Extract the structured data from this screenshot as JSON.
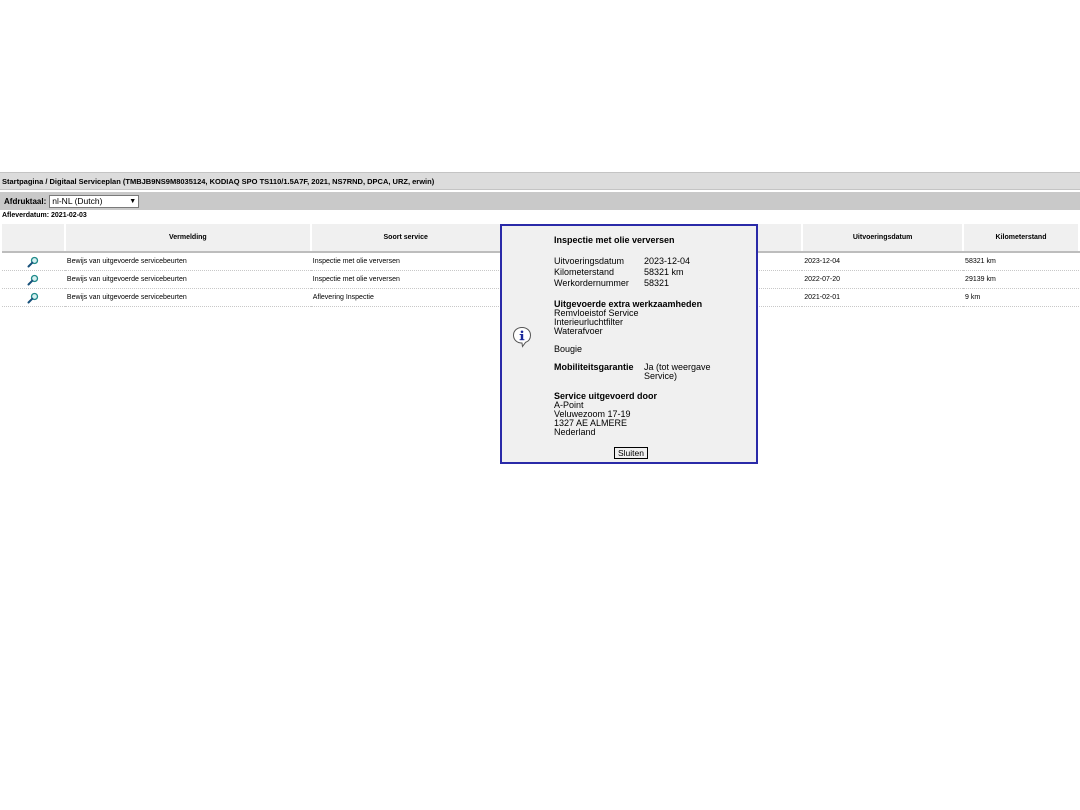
{
  "breadcrumb": "Startpagina / Digitaal Serviceplan (TMBJB9NS9M8035124, KODIAQ SPO TS110/1.5A7F, 2021, NS7RND, DPCA, URZ, erwin)",
  "language": {
    "label": "Afdruktaal:",
    "selected": "nl-NL (Dutch)"
  },
  "delivery_date": "Afleverdatum: 2021-02-03",
  "table": {
    "headers": [
      "",
      "Vermelding",
      "Soort service",
      "",
      "Uitvoeringsdatum",
      "Kilometerstand"
    ],
    "rows": [
      {
        "icon": "magnifier-icon",
        "vermelding": "Bewijs van uitgevoerde servicebeurten",
        "soort": "Inspectie met olie verversen",
        "datum": "2023-12-04",
        "km": "58321 km"
      },
      {
        "icon": "magnifier-icon",
        "vermelding": "Bewijs van uitgevoerde servicebeurten",
        "soort": "Inspectie met olie verversen",
        "datum": "2022-07-20",
        "km": "29139 km"
      },
      {
        "icon": "magnifier-icon",
        "vermelding": "Bewijs van uitgevoerde servicebeurten",
        "soort": "Aflevering Inspectie",
        "datum": "2021-02-01",
        "km": "9 km"
      }
    ]
  },
  "modal": {
    "icon": "info-icon",
    "title": "Inspectie met olie verversen",
    "fields": [
      {
        "label": "Uitvoeringsdatum",
        "value": "2023-12-04"
      },
      {
        "label": "Kilometerstand",
        "value": "58321 km"
      },
      {
        "label": "Werkordernummer",
        "value": "58321"
      }
    ],
    "extra_heading": "Uitgevoerde extra werkzaamheden",
    "extra_items": [
      "Remvloeistof Service",
      "Interieurluchtfilter",
      "Waterafvoer",
      "Bougie"
    ],
    "mobility_label": "Mobiliteitsgarantie",
    "mobility_value": "Ja (tot weergave Service)",
    "service_heading": "Service uitgevoerd door",
    "service_lines": [
      "A-Point",
      "Veluwezoom 17-19",
      "1327 AE ALMERE",
      "Nederland"
    ],
    "close_label": "Sluiten"
  }
}
